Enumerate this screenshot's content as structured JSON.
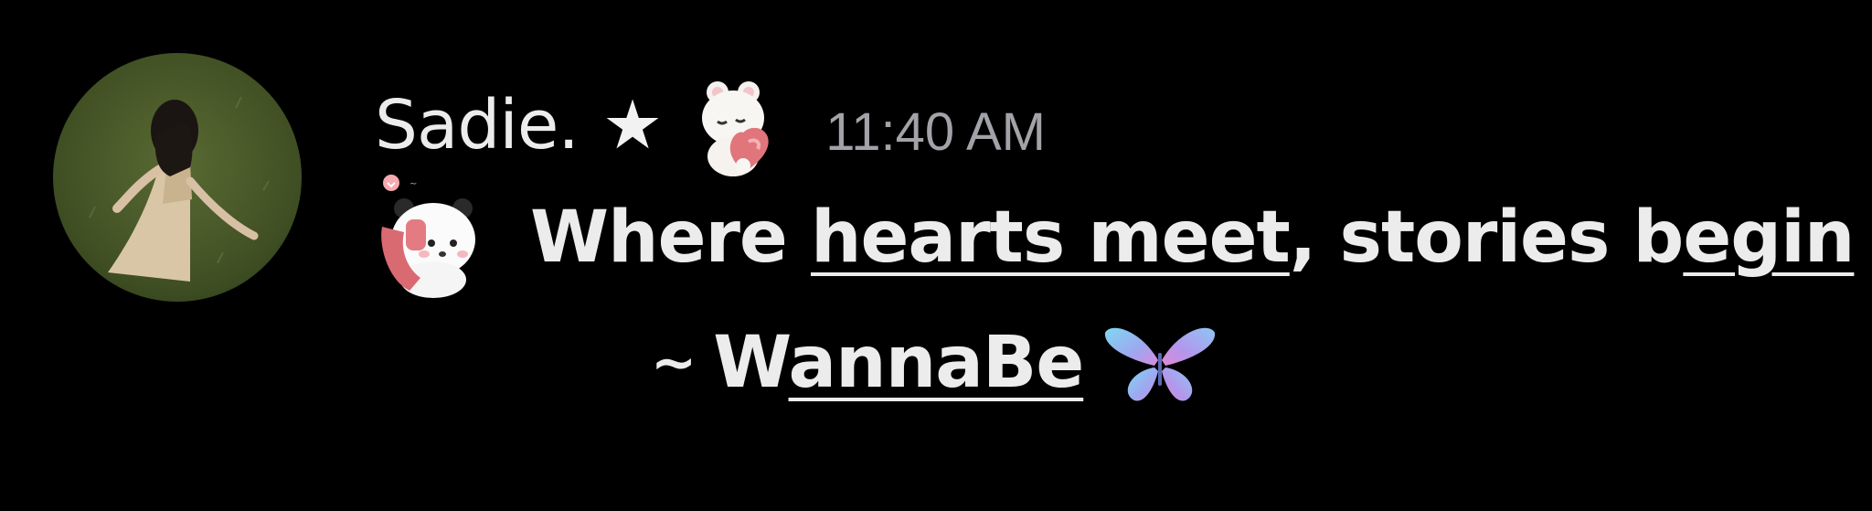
{
  "message": {
    "author": "Sadie.",
    "author_star": "★",
    "timestamp": "11:40 AM",
    "text_parts": [
      "Where ",
      "hearts meet",
      ", stories b",
      "egin"
    ],
    "signature_prefix": "~",
    "signature_parts": [
      "W",
      "annaBe"
    ]
  },
  "icons": {
    "author_badge": "bear-hugging-heart-emoji",
    "message_sticker": "panda-on-phone-sticker",
    "signature_emoji": "butterfly-emoji"
  },
  "colors": {
    "background": "#000000",
    "text": "#ececec",
    "timestamp": "#a2a3a8"
  }
}
